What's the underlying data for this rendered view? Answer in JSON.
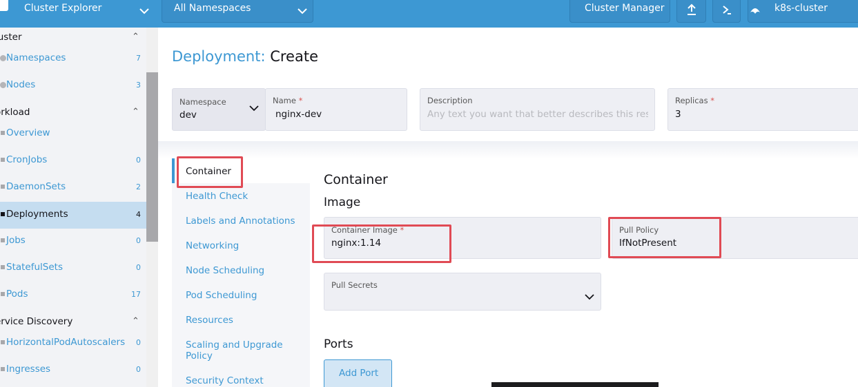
{
  "topbar": {
    "product": "Cluster Explorer",
    "namespace_filter": "All Namespaces",
    "cluster_manager": "Cluster Manager",
    "cluster_name": "k8s-cluster",
    "icons": [
      "logo-icon",
      "chevron-down-icon",
      "upload-icon",
      "terminal-icon",
      "cluster-icon"
    ]
  },
  "sidebar": {
    "groups": [
      {
        "label": "luster"
      },
      {
        "label": "orkload"
      },
      {
        "label": "ervice Discovery"
      }
    ],
    "items": [
      {
        "label": "Namespaces",
        "count": "7"
      },
      {
        "label": "Nodes",
        "count": "3"
      },
      {
        "label": "Overview",
        "count": ""
      },
      {
        "label": "CronJobs",
        "count": "0"
      },
      {
        "label": "DaemonSets",
        "count": "2"
      },
      {
        "label": "Deployments",
        "count": "4"
      },
      {
        "label": "Jobs",
        "count": "0"
      },
      {
        "label": "StatefulSets",
        "count": "0"
      },
      {
        "label": "Pods",
        "count": "17"
      },
      {
        "label": "HorizontalPodAutoscalers",
        "count": "0"
      },
      {
        "label": "Ingresses",
        "count": "0"
      }
    ],
    "active_item": "Deployments"
  },
  "page": {
    "kind": "Deployment:",
    "verb": "Create"
  },
  "form": {
    "namespace": {
      "label": "Namespace",
      "value": "dev"
    },
    "name": {
      "label": "Name",
      "required": "*",
      "value": "nginx-dev"
    },
    "description": {
      "label": "Description",
      "placeholder": "Any text you want that better describes this resource"
    },
    "replicas": {
      "label": "Replicas",
      "required": "*",
      "value": "3"
    }
  },
  "tabs": [
    "Container",
    "Health Check",
    "Labels and Annotations",
    "Networking",
    "Node Scheduling",
    "Pod Scheduling",
    "Resources",
    "Scaling and Upgrade Policy",
    "Security Context"
  ],
  "active_tab": "Container",
  "container": {
    "heading": "Container",
    "image_heading": "Image",
    "container_image": {
      "label": "Container Image",
      "required": "*",
      "value": "nginx:1.14"
    },
    "pull_policy": {
      "label": "Pull Policy",
      "value": "IfNotPresent"
    },
    "pull_secrets": {
      "label": "Pull Secrets"
    },
    "ports_heading": "Ports",
    "add_port": "Add Port"
  },
  "colors": {
    "accent": "#3d98d3",
    "highlight": "#e04a54",
    "required": "#d9534f",
    "active_nav": "#c5ddf0"
  }
}
